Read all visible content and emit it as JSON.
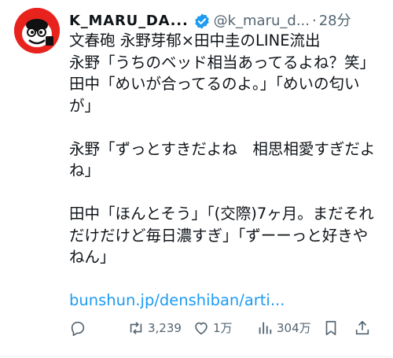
{
  "tweet": {
    "display_name": "K_MARU_DA...",
    "handle": "@k_maru_d...",
    "separator": "·",
    "time": "28分",
    "lines": [
      "文春砲 永野芽郁×田中圭のLINE流出",
      "永野「うちのベッド相当あってるよね？笑」",
      "田中「めいが合ってるのよ。」「めいの匂い",
      "が」",
      "",
      "永野「ずっとすきだよね　相思相愛すぎだよ",
      "ね」",
      "",
      "田中「ほんとそう」「(交際)7ヶ月。まだそれ",
      "だけだけど毎日濃すぎ」「ずーーっと好きや",
      "ねん」",
      ""
    ],
    "link": "bunshun.jp/denshiban/arti..."
  },
  "actions": {
    "reply_icon": "speech-bubble-icon",
    "retweet_icon": "retweet-arrows-icon",
    "retweet_count": "3,239",
    "like_icon": "heart-icon",
    "like_count": "1万",
    "views_icon": "bar-chart-icon",
    "views_count": "304万",
    "bookmark_icon": "bookmark-icon",
    "share_icon": "share-upload-icon"
  },
  "colors": {
    "text": "#0f1419",
    "secondary": "#536471",
    "link": "#1d9bf0",
    "verified": "#1d9bf0",
    "avatar_bg": "#e8231e"
  }
}
